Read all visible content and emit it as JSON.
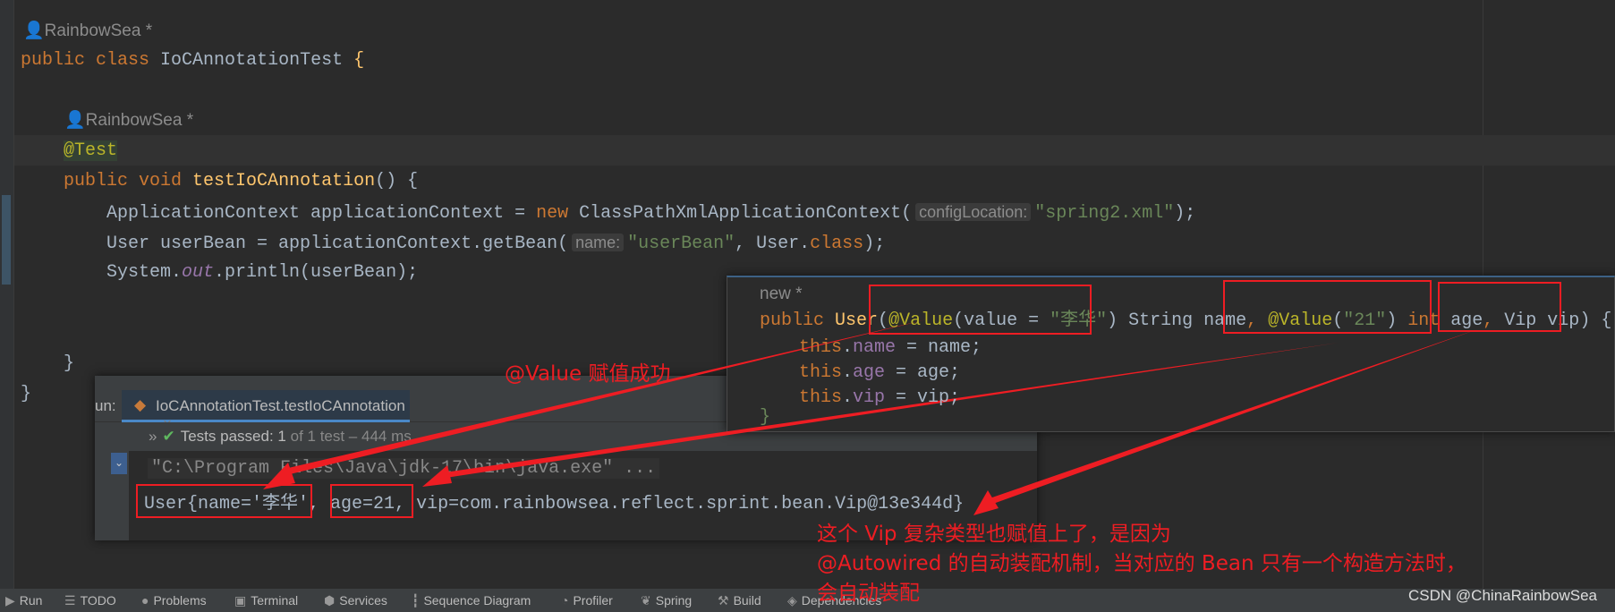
{
  "editor": {
    "author1": "RainbowSea *",
    "class_kw": "public class",
    "class_name": "IoCAnnotationTest",
    "brace_open": "{",
    "author2": "RainbowSea *",
    "annotation": "@Test",
    "method_kw": "public void",
    "method_name": "testIoCAnnotation",
    "method_tail": "() {",
    "line1_a": "ApplicationContext applicationContext = ",
    "line1_new": "new",
    "line1_b": " ClassPathXmlApplicationContext(",
    "line1_hint": "configLocation:",
    "line1_str": "\"spring2.xml\"",
    "line1_end": ");",
    "line2_a": "User userBean = applicationContext.getBean(",
    "line2_hint": "name:",
    "line2_str": "\"userBean\"",
    "line2_b": ", User.",
    "line2_kw": "class",
    "line2_end": ");",
    "line3_a": "System.",
    "line3_out": "out",
    "line3_b": ".println(userBean);",
    "close_method": "}",
    "close_class": "}"
  },
  "popup": {
    "author": "new *",
    "sig_kw": "public",
    "sig_name": "User",
    "p1_ann": "@Value",
    "p1_a": "(value = ",
    "p1_str": "\"李华\"",
    "p1_b": ") String name",
    "comma": ",",
    "p2_ann": "@Value",
    "p2_a": "(",
    "p2_str": "\"21\"",
    "p2_b": ") ",
    "p2_kw": "int",
    "p2_c": " age",
    "p3": " Vip vip) {",
    "this_kw": "this",
    "f1": "name",
    "v1": " = name;",
    "f2": "age",
    "v2": " = age;",
    "f3": "vip",
    "v3": " = vip;",
    "close": "}"
  },
  "run": {
    "label": "un:",
    "tab": "IoCAnnotationTest.testIoCAnnotation",
    "tab_close": "×",
    "status_prefix": "Tests passed:",
    "status_count": "1",
    "status_rest": "of 1 test – 444 ms",
    "cmd": "\"C:\\Program Files\\Java\\jdk-17\\bin\\java.exe\" ...",
    "output_name": "User{name='李华'",
    "output_sep": ", ",
    "output_age": "age=21,",
    "output_rest": " vip=com.rainbowsea.reflect.sprint.bean.Vip@13e344d}"
  },
  "toolbar": [
    {
      "icon": "run-icon",
      "glyph": "▶",
      "label": "Run"
    },
    {
      "icon": "todo-icon",
      "glyph": "☰",
      "label": "TODO"
    },
    {
      "icon": "problems-icon",
      "glyph": "●",
      "label": "Problems"
    },
    {
      "icon": "terminal-icon",
      "glyph": "▣",
      "label": "Terminal"
    },
    {
      "icon": "services-icon",
      "glyph": "⬢",
      "label": "Services"
    },
    {
      "icon": "sequence-diagram-icon",
      "glyph": "┇",
      "label": "Sequence Diagram"
    },
    {
      "icon": "profiler-icon",
      "glyph": "◔",
      "label": "Profiler"
    },
    {
      "icon": "spring-icon",
      "glyph": "❦",
      "label": "Spring"
    },
    {
      "icon": "build-icon",
      "glyph": "⚒",
      "label": "Build"
    },
    {
      "icon": "dependencies-icon",
      "glyph": "◈",
      "label": "Dependencies"
    }
  ],
  "annotations": {
    "value_note": "@Value 赋值成功",
    "vip_note_1": "这个 Vip 复杂类型也赋值上了，是因为",
    "vip_note_2": "@Autowired 的自动装配机制，当对应的 Bean 只有一个构造方法时，",
    "vip_note_3": "会自动装配",
    "color": "#ee1d23"
  },
  "watermark": "CSDN @ChinaRainbowSea"
}
